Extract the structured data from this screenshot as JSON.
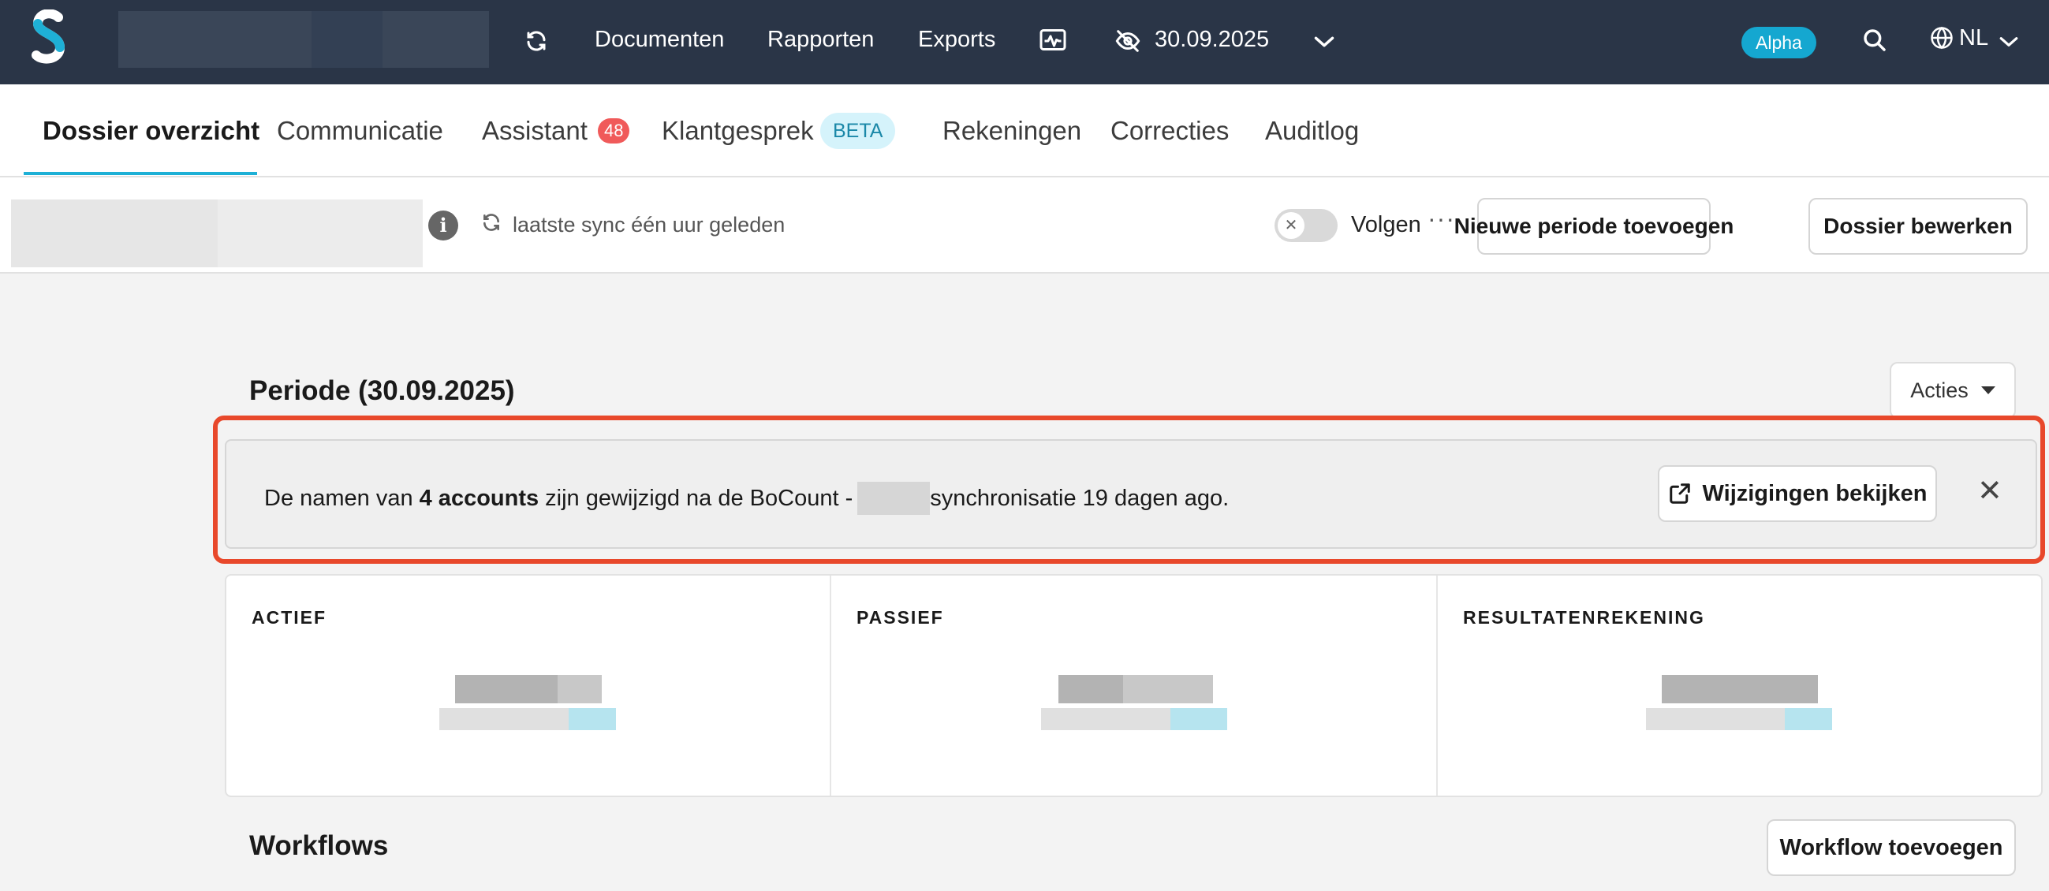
{
  "topbar": {
    "nav": [
      "Documenten",
      "Rapporten",
      "Exports"
    ],
    "period_label": "30.09.2025",
    "env_badge": "Alpha",
    "language": "NL",
    "icons": {
      "logo": "s-logo",
      "refresh": "refresh-icon",
      "monitor": "activity-monitor-icon",
      "visibility": "eye-off-icon",
      "chevron": "chevron-down-icon",
      "search": "search-icon",
      "globe": "globe-icon"
    }
  },
  "tabs": [
    {
      "label": "Dossier overzicht",
      "active": true
    },
    {
      "label": "Communicatie"
    },
    {
      "label": "Assistant",
      "badge": "48"
    },
    {
      "label": "Klantgesprek",
      "badge": "BETA"
    },
    {
      "label": "Rekeningen"
    },
    {
      "label": "Correcties"
    },
    {
      "label": "Auditlog"
    }
  ],
  "toolbar": {
    "sync_text": "laatste sync één uur geleden",
    "follow_label": "Volgen",
    "follow_on": false,
    "more": "···",
    "new_period_button": "Nieuwe periode toevoegen",
    "edit_dossier_button": "Dossier bewerken"
  },
  "period": {
    "title": "Periode (30.09.2025)",
    "actions_button": "Acties"
  },
  "notice": {
    "prefix": "De namen van",
    "bold": "4 accounts",
    "middle": "zijn gewijzigd na de BoCount -",
    "suffix": "synchronisatie 19 dagen ago.",
    "button": "Wijzigingen bekijken",
    "close": "✕"
  },
  "summary": {
    "columns": [
      "ACTIEF",
      "PASSIEF",
      "RESULTATENREKENING"
    ]
  },
  "workflows": {
    "title": "Workflows",
    "add_button": "Workflow toevoegen"
  },
  "colors": {
    "topbar": "#2a3547",
    "accent": "#1eb0d6",
    "highlight": "#e8482b",
    "badge_red": "#f05a5a"
  }
}
